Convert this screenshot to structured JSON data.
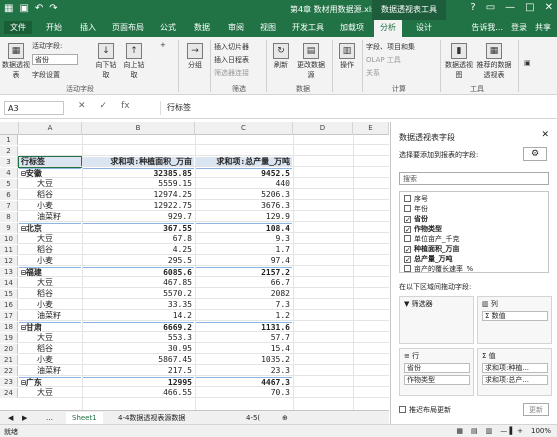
{
  "window": {
    "title": "第4章 数材用数据源.xlsx - Excel",
    "context_tab": "数据透视表工具",
    "buttons": [
      "?",
      "□",
      "—",
      "□",
      "✕"
    ]
  },
  "ribbon_tabs": [
    "文件",
    "开始",
    "插入",
    "页面布局",
    "公式",
    "数据",
    "审阅",
    "视图",
    "开发工具",
    "加载项",
    "分析",
    "设计"
  ],
  "ribbon_right": [
    "告诉我...",
    "登录",
    "共享"
  ],
  "ribbon": {
    "pivot_table_label": "数据透视表",
    "active_field_label": "活动字段:",
    "active_field_value": "省份",
    "field_settings": "字段设置",
    "drill_down": "向下钻取",
    "drill_up": "向上钻取",
    "active_field_group": "活动字段",
    "group_label": "分组",
    "insert_slicer": "插入切片器",
    "insert_timeline": "插入日程表",
    "filter_connections": "筛选器连接",
    "filter_group": "筛选",
    "refresh": "刷新",
    "change_source": "更改数据源",
    "data_group": "数据",
    "actions": "操作",
    "fields_items": "字段、项目和集",
    "olap_tools": "OLAP 工具",
    "relations": "关系",
    "calc_group": "计算",
    "pivot_chart": "数据透视图",
    "recommended": "推荐的数据透视表",
    "tools_group": "工具"
  },
  "formula_bar": {
    "name_box": "A3",
    "fx": "fx",
    "content": "行标签"
  },
  "grid": {
    "columns": [
      "A",
      "B",
      "C",
      "D",
      "E"
    ],
    "header_row": {
      "num": "3",
      "a": "行标签",
      "b": "求和项:种植面积_万亩",
      "c": "求和项:总产量_万吨"
    },
    "rows": [
      {
        "num": "1",
        "a": "",
        "b": "",
        "c": "",
        "type": "empty"
      },
      {
        "num": "2",
        "a": "",
        "b": "",
        "c": "",
        "type": "empty"
      },
      {
        "num": "4",
        "a": "⊟安徽",
        "b": "32385.85",
        "c": "9452.5",
        "type": "prov"
      },
      {
        "num": "5",
        "a": "大豆",
        "b": "5559.15",
        "c": "440",
        "type": "item"
      },
      {
        "num": "6",
        "a": "稻谷",
        "b": "12974.25",
        "c": "5206.3",
        "type": "item"
      },
      {
        "num": "7",
        "a": "小麦",
        "b": "12922.75",
        "c": "3676.3",
        "type": "item"
      },
      {
        "num": "8",
        "a": "油菜籽",
        "b": "929.7",
        "c": "129.9",
        "type": "item"
      },
      {
        "num": "9",
        "a": "⊟北京",
        "b": "367.55",
        "c": "108.4",
        "type": "prov"
      },
      {
        "num": "10",
        "a": "大豆",
        "b": "67.8",
        "c": "9.3",
        "type": "item"
      },
      {
        "num": "11",
        "a": "稻谷",
        "b": "4.25",
        "c": "1.7",
        "type": "item"
      },
      {
        "num": "12",
        "a": "小麦",
        "b": "295.5",
        "c": "97.4",
        "type": "item"
      },
      {
        "num": "13",
        "a": "⊟福建",
        "b": "6085.6",
        "c": "2157.2",
        "type": "prov"
      },
      {
        "num": "14",
        "a": "大豆",
        "b": "467.85",
        "c": "66.7",
        "type": "item"
      },
      {
        "num": "15",
        "a": "稻谷",
        "b": "5570.2",
        "c": "2082",
        "type": "item"
      },
      {
        "num": "16",
        "a": "小麦",
        "b": "33.35",
        "c": "7.3",
        "type": "item"
      },
      {
        "num": "17",
        "a": "油菜籽",
        "b": "14.2",
        "c": "1.2",
        "type": "item"
      },
      {
        "num": "18",
        "a": "⊟甘肃",
        "b": "6669.2",
        "c": "1131.6",
        "type": "prov"
      },
      {
        "num": "19",
        "a": "大豆",
        "b": "553.3",
        "c": "57.7",
        "type": "item"
      },
      {
        "num": "20",
        "a": "稻谷",
        "b": "30.95",
        "c": "15.4",
        "type": "item"
      },
      {
        "num": "21",
        "a": "小麦",
        "b": "5867.45",
        "c": "1035.2",
        "type": "item"
      },
      {
        "num": "22",
        "a": "油菜籽",
        "b": "217.5",
        "c": "23.3",
        "type": "item"
      },
      {
        "num": "23",
        "a": "⊟广东",
        "b": "12995",
        "c": "4467.3",
        "type": "prov"
      },
      {
        "num": "24",
        "a": "大豆",
        "b": "466.55",
        "c": "70.3",
        "type": "item"
      }
    ]
  },
  "sheet_tabs": [
    "Sheet1",
    "4-4数据透视表源数据",
    "4-5("
  ],
  "status": {
    "ready": "就绪",
    "zoom": "100%"
  },
  "pane": {
    "title": "数据透视表字段",
    "subtitle": "选择要添加到报表的字段:",
    "search_placeholder": "搜索",
    "fields": [
      {
        "label": "序号",
        "checked": false
      },
      {
        "label": "年份",
        "checked": false
      },
      {
        "label": "省份",
        "checked": true
      },
      {
        "label": "作物类型",
        "checked": true
      },
      {
        "label": "单位亩产_千克",
        "checked": false
      },
      {
        "label": "种植面积_万亩",
        "checked": true
      },
      {
        "label": "总产量_万吨",
        "checked": true
      },
      {
        "label": "亩产的覆长速率_%",
        "checked": false
      }
    ],
    "drag_label": "在以下区域间拖动字段:",
    "area_filter": "筛选器",
    "area_columns": "列",
    "columns_item": "Σ 数值",
    "area_rows": "行",
    "rows_items": [
      "省份",
      "作物类型"
    ],
    "area_values": "值",
    "values_items": [
      "求和项:种植...",
      "求和项:总产..."
    ],
    "defer_label": "推迟布局更新",
    "update_label": "更新"
  }
}
